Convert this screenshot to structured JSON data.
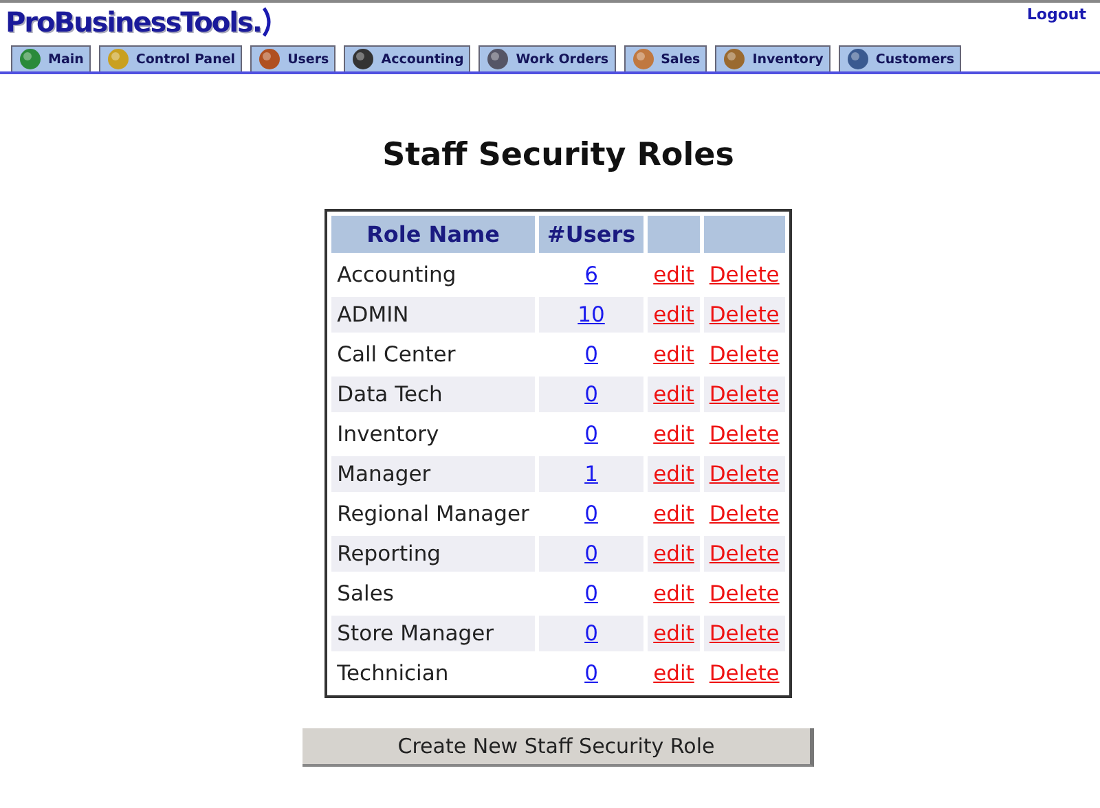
{
  "logo": "ProBusinessTools.",
  "logout": "Logout",
  "tabs": [
    {
      "label": "Main"
    },
    {
      "label": "Control Panel"
    },
    {
      "label": "Users"
    },
    {
      "label": "Accounting"
    },
    {
      "label": "Work Orders"
    },
    {
      "label": "Sales"
    },
    {
      "label": "Inventory"
    },
    {
      "label": "Customers"
    }
  ],
  "title": "Staff Security Roles",
  "table": {
    "columns": [
      "Role Name",
      "#Users"
    ],
    "rows": [
      {
        "role": "Accounting",
        "users": "6",
        "edit": "edit",
        "delete": "Delete"
      },
      {
        "role": "ADMIN",
        "users": "10",
        "edit": "edit",
        "delete": "Delete"
      },
      {
        "role": "Call Center",
        "users": "0",
        "edit": "edit",
        "delete": "Delete"
      },
      {
        "role": "Data Tech",
        "users": "0",
        "edit": "edit",
        "delete": "Delete"
      },
      {
        "role": "Inventory",
        "users": "0",
        "edit": "edit",
        "delete": "Delete"
      },
      {
        "role": "Manager",
        "users": "1",
        "edit": "edit",
        "delete": "Delete"
      },
      {
        "role": "Regional Manager",
        "users": "0",
        "edit": "edit",
        "delete": "Delete"
      },
      {
        "role": "Reporting",
        "users": "0",
        "edit": "edit",
        "delete": "Delete"
      },
      {
        "role": "Sales",
        "users": "0",
        "edit": "edit",
        "delete": "Delete"
      },
      {
        "role": "Store Manager",
        "users": "0",
        "edit": "edit",
        "delete": "Delete"
      },
      {
        "role": "Technician",
        "users": "0",
        "edit": "edit",
        "delete": "Delete"
      }
    ]
  },
  "create_button": "Create New Staff Security Role"
}
